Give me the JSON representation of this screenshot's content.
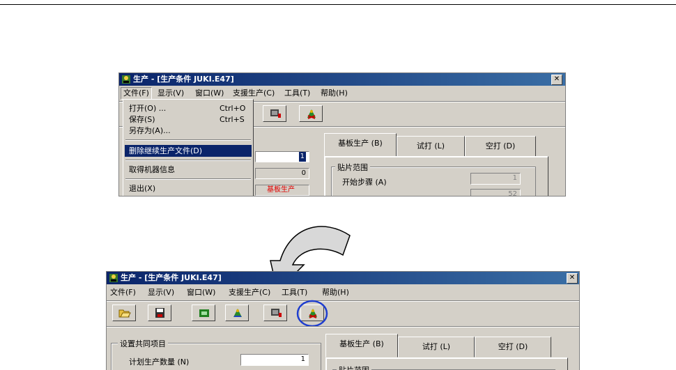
{
  "window1": {
    "title": "生产 - [生产条件 JUKI.E47]",
    "close": "✕",
    "menu": [
      "文件(F)",
      "显示(V)",
      "窗口(W)",
      "支援生产(C)",
      "工具(T)",
      "帮助(H)"
    ],
    "dropdown": {
      "items": [
        {
          "label": "打开(O) ...",
          "shortcut": "Ctrl+O"
        },
        {
          "label": "保存(S)",
          "shortcut": "Ctrl+S"
        },
        {
          "label": "另存为(A)...",
          "shortcut": ""
        },
        {
          "label": "删除继续生产文件(D)",
          "shortcut": ""
        },
        {
          "label": "取得机器信息",
          "shortcut": ""
        },
        {
          "label": "退出(X)",
          "shortcut": ""
        }
      ]
    },
    "field_value": "1",
    "field_value2": "0",
    "red_text": "基板生产",
    "tabs": [
      "基板生产 (B)",
      "试打 (L)",
      "空打 (D)"
    ],
    "group_label": "贴片范围",
    "start_step_label": "开始步骤 (A)",
    "start_step_value": "1",
    "end_value_partial": "52"
  },
  "window2": {
    "title": "生产 - [生产条件 JUKI.E47]",
    "close": "✕",
    "menu": [
      "文件(F)",
      "显示(V)",
      "窗口(W)",
      "支援生产(C)",
      "工具(T)",
      "帮助(H)"
    ],
    "group_label": "设置共同项目",
    "plan_qty_label": "计划生产数量 (N)",
    "plan_qty_value": "1",
    "tabs": [
      "基板生产 (B)",
      "试打 (L)",
      "空打 (D)"
    ],
    "group2_label": "贴片范围"
  },
  "icons": [
    "open-folder-icon",
    "save-disk-icon",
    "machine-icon",
    "production-icon",
    "board-icon",
    "delete-production-icon"
  ],
  "colors": {
    "titlebar": "#0a246a",
    "highlight": "#0a246a",
    "circle": "#1f3ecf",
    "red": "#e00000"
  }
}
